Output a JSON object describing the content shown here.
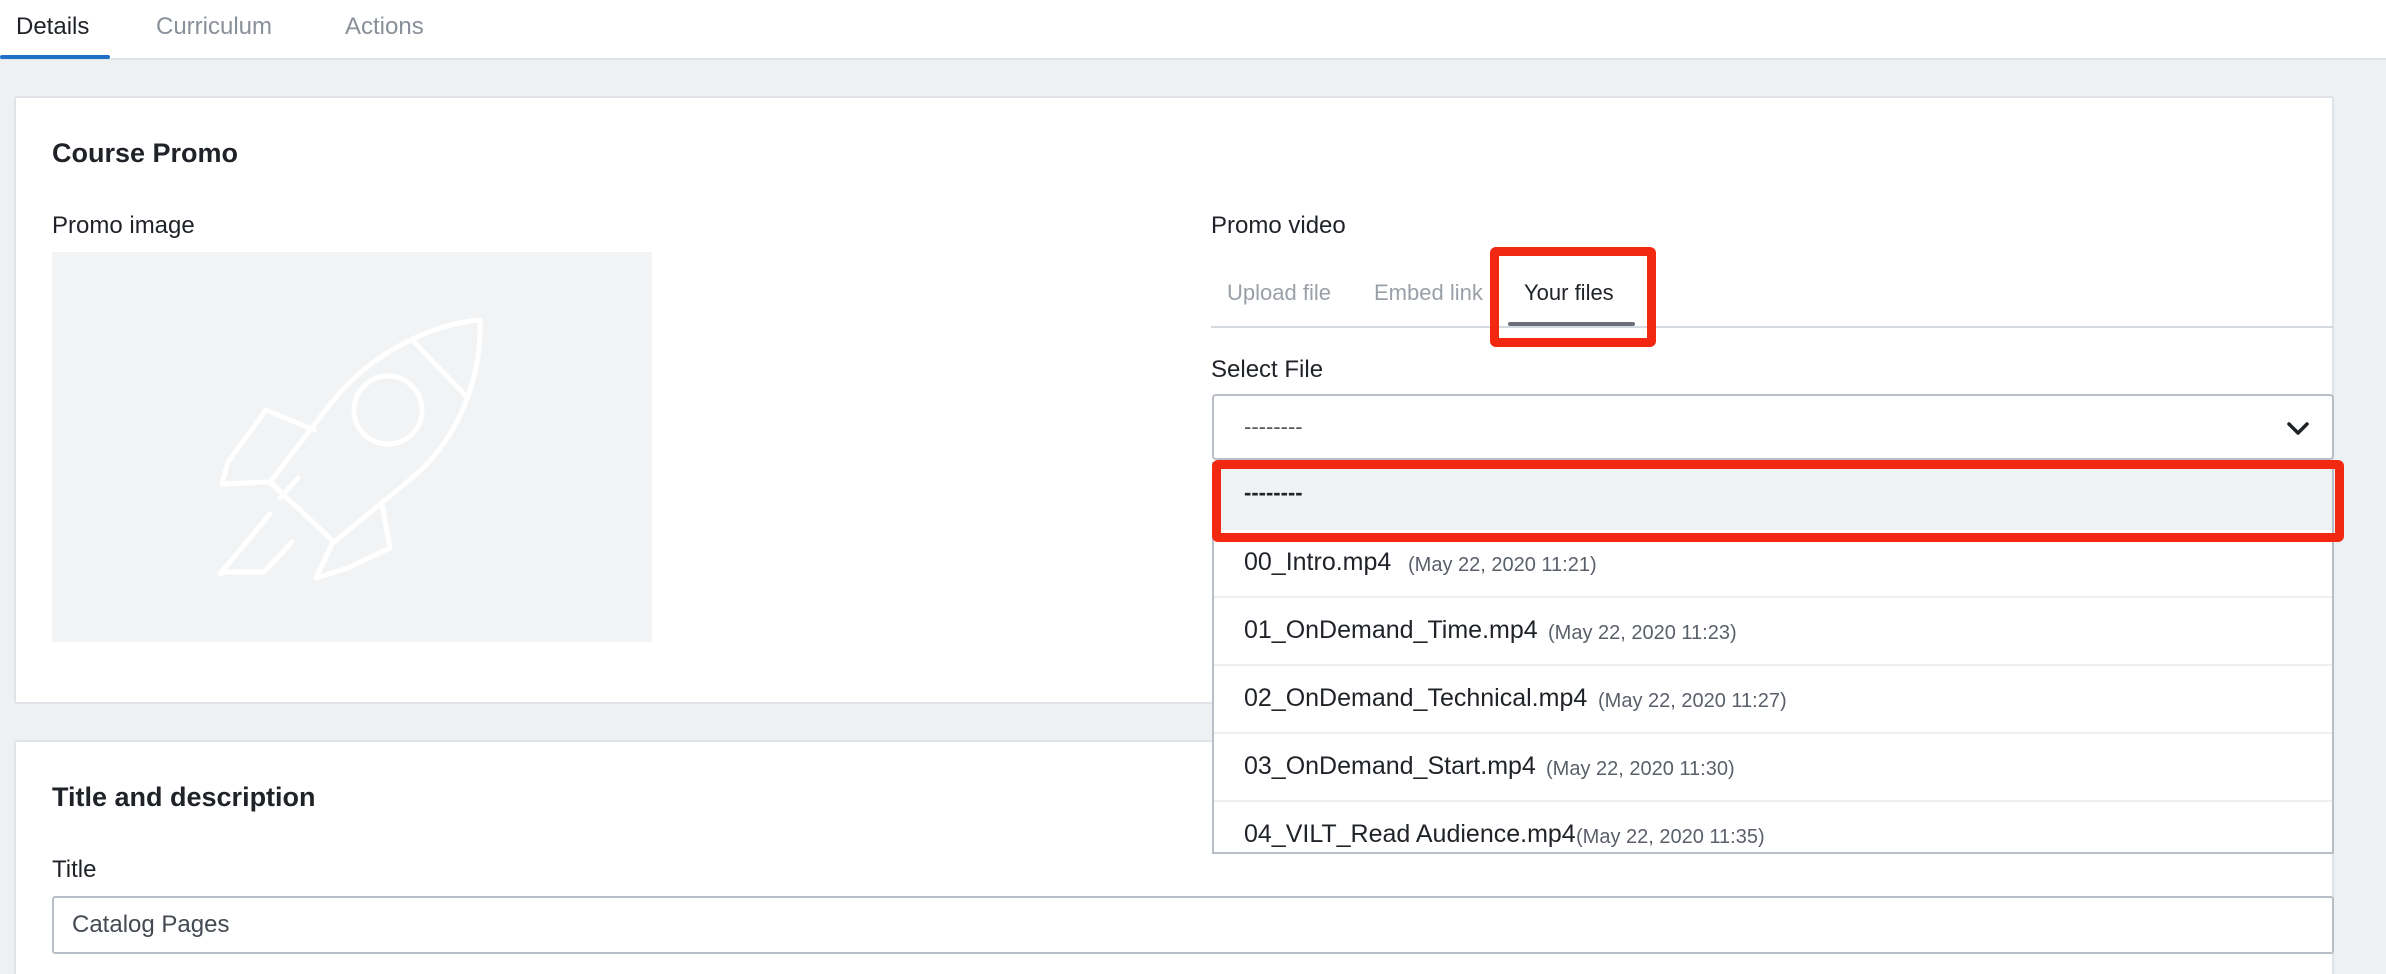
{
  "top_tabs": [
    {
      "label": "Details",
      "active": true
    },
    {
      "label": "Curriculum",
      "active": false
    },
    {
      "label": "Actions",
      "active": false
    }
  ],
  "course_promo": {
    "title": "Course Promo",
    "promo_image_label": "Promo image",
    "promo_image_icon": "rocket-icon",
    "promo_video_label": "Promo video",
    "video_tabs": [
      {
        "label": "Upload file",
        "active": false
      },
      {
        "label": "Embed link",
        "active": false
      },
      {
        "label": "Your files",
        "active": true
      }
    ],
    "select_file_label": "Select File",
    "select_value": "--------",
    "options": [
      {
        "name": "--------",
        "date": "",
        "selected": true
      },
      {
        "name": "00_Intro.mp4",
        "date": "(May 22, 2020 11:21)"
      },
      {
        "name": "01_OnDemand_Time.mp4",
        "date": "(May 22, 2020 11:23)"
      },
      {
        "name": "02_OnDemand_Technical.mp4",
        "date": "(May 22, 2020 11:27)"
      },
      {
        "name": "03_OnDemand_Start.mp4",
        "date": "(May 22, 2020 11:30)"
      },
      {
        "name": "04_VILT_Read Audience.mp4",
        "date": "(May 22, 2020 11:35)"
      }
    ]
  },
  "title_description": {
    "title": "Title and description",
    "title_label": "Title",
    "title_value": "Catalog Pages"
  },
  "colors": {
    "accent": "#1f6fc7",
    "highlight": "#f22810",
    "background": "#eef1f4"
  }
}
